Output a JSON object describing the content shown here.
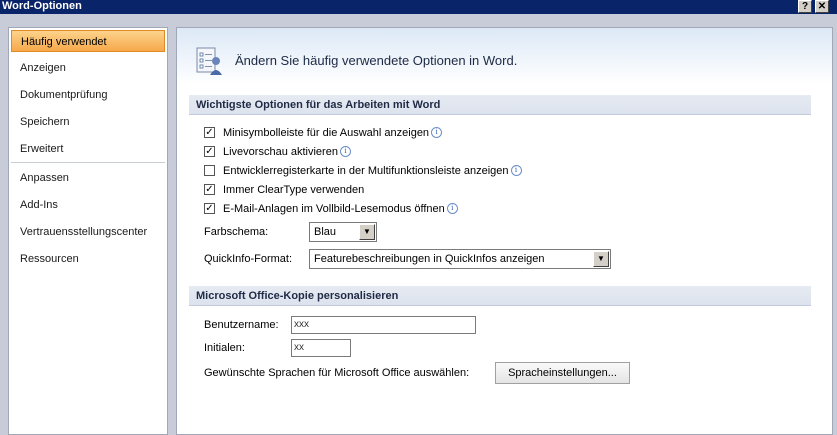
{
  "window": {
    "title": "Word-Optionen",
    "help_btn": "?",
    "close_btn": "✕"
  },
  "sidebar": {
    "items": [
      {
        "label": "Häufig verwendet",
        "active": true
      },
      {
        "label": "Anzeigen"
      },
      {
        "label": "Dokumentprüfung"
      },
      {
        "label": "Speichern"
      },
      {
        "label": "Erweitert"
      },
      {
        "label": "Anpassen"
      },
      {
        "label": "Add-Ins"
      },
      {
        "label": "Vertrauensstellungscenter"
      },
      {
        "label": "Ressourcen"
      }
    ]
  },
  "header": {
    "text": "Ändern Sie häufig verwendete Optionen in Word.",
    "icon": "options-icon"
  },
  "section1": {
    "title": "Wichtigste Optionen für das Arbeiten mit Word",
    "options": [
      {
        "label": "Minisymbolleiste für die Auswahl anzeigen",
        "checked": true,
        "info": true
      },
      {
        "label": "Livevorschau aktivieren",
        "checked": true,
        "info": true
      },
      {
        "label": "Entwicklerregisterkarte in der Multifunktionsleiste anzeigen",
        "checked": false,
        "info": true
      },
      {
        "label": "Immer ClearType verwenden",
        "checked": true,
        "info": false
      },
      {
        "label": "E-Mail-Anlagen im Vollbild-Lesemodus öffnen",
        "checked": true,
        "info": true
      }
    ],
    "color_scheme_label": "Farbschema:",
    "color_scheme_value": "Blau",
    "quickinfo_label": "QuickInfo-Format:",
    "quickinfo_value": "Featurebeschreibungen in QuickInfos anzeigen"
  },
  "section2": {
    "title": "Microsoft Office-Kopie personalisieren",
    "username_label": "Benutzername:",
    "username_value": "xxx",
    "initials_label": "Initialen:",
    "initials_value": "xx",
    "languages_label": "Gewünschte Sprachen für Microsoft Office auswählen:",
    "languages_button": "Spracheinstellungen..."
  },
  "colors": {
    "title_bar": "#0a246a",
    "active_item": "#f7a84a",
    "section_bg": "#e6eaf2"
  }
}
